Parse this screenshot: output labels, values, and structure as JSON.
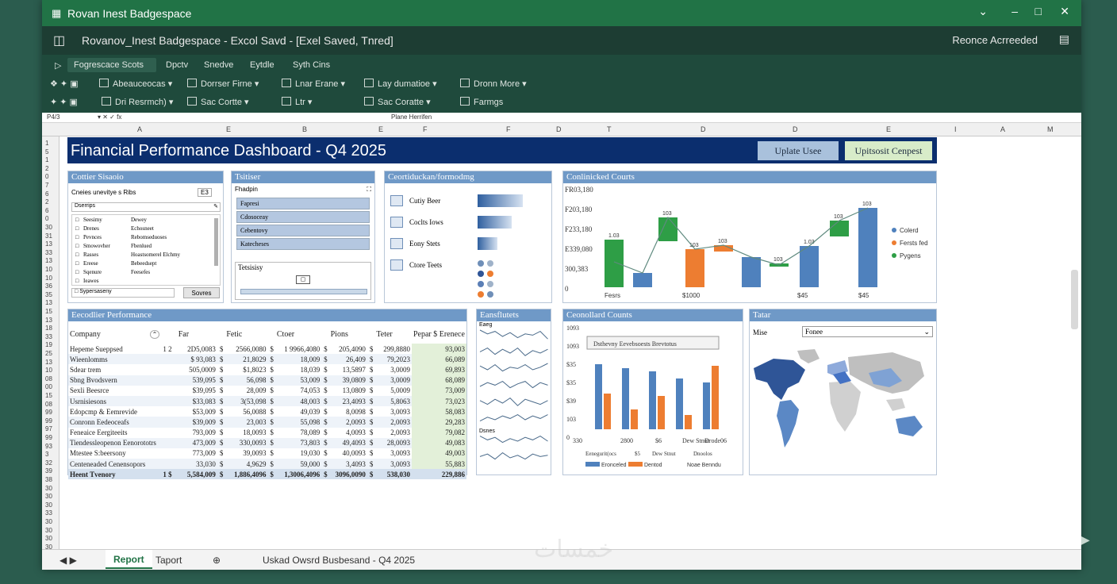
{
  "window": {
    "title": "Rovan Inest Badgespace",
    "app_title": "Rovanov_Inest Badgespace - Excol Savd - [Exel Saved, Tnred]",
    "right_status": "Reonce Acrreeded"
  },
  "ribbon": {
    "tabs": [
      "Fogrescace Scots",
      "Dpctv",
      "Snedve",
      "Eytdle",
      "Syth Cins"
    ],
    "row1": [
      "Abeauceocas",
      "Dorrser Firne",
      "Lnar Erane",
      "Lay dumatioe",
      "Dronn More"
    ],
    "row2": [
      "Dri Resrmch)",
      "Sac Cortte",
      "Ltr",
      "Sac Coratte",
      "Farmgs"
    ]
  },
  "formula": {
    "cell": "P4/3",
    "content": "Plane Herrifen"
  },
  "columns": [
    "A",
    "E",
    "B",
    "E",
    "F",
    "F",
    "D",
    "T",
    "D",
    "D",
    "E",
    "I",
    "A",
    "M"
  ],
  "rows": [
    "1",
    "5",
    "1",
    "2",
    "0",
    "7",
    "6",
    "2",
    "6",
    "0",
    "30",
    "31",
    "13",
    "33",
    "13",
    "10",
    "10",
    "36",
    "35",
    "13",
    "15",
    "13",
    "18",
    "33",
    "19",
    "25",
    "13",
    "10",
    "08",
    "00",
    "15",
    "08",
    "99",
    "99",
    "97",
    "99",
    "93",
    "3",
    "32",
    "39",
    "38",
    "30",
    "30",
    "30",
    "33",
    "30",
    "30",
    "30",
    "30"
  ],
  "dashboard": {
    "title": "Financial Performance Dashboard - Q4 2025",
    "btn_update": "Uplate Usee",
    "btn_export": "Upitsosit Cenpest"
  },
  "filter_panel": {
    "title": "Cottier Sisaoio",
    "top_label": "Cneies unevitye s Ribs",
    "top_value": "E3",
    "search": "Dserrips",
    "rows": [
      [
        "Seesimy",
        "Dewey"
      ],
      [
        "Drenes",
        "Echosneet"
      ],
      [
        "Pevnces",
        "Rebomseduoses"
      ],
      [
        "Smowovher",
        "Fbenlued"
      ],
      [
        "Rasses",
        "Hoastsomerel Elchmy"
      ],
      [
        "Ereese",
        "Bebeedsept"
      ],
      [
        "Sqenure",
        "Feesefes"
      ],
      [
        "Ieawes",
        ""
      ]
    ],
    "footer_label": "Sypersaseny",
    "footer_btn": "Sovres"
  },
  "slicer_panel": {
    "title": "Tsitiser",
    "hdr": "Fhadpin",
    "items": [
      "Fapresi",
      "Cdosoceay",
      "Cebentovy",
      "Katecheses"
    ],
    "slider_label": "Tetsisisy"
  },
  "cond_panel": {
    "title": "Ceortiduckan/formodmg",
    "items": [
      "Cutiy Beer",
      "Coclts Iows",
      "Eony Stets",
      "Ctore Teets"
    ],
    "bars": [
      0.95,
      0.72,
      0.42
    ]
  },
  "waterfall": {
    "title": "Conlinicked Courts",
    "yticks": [
      "FR03,180",
      "F203,180",
      "F233,180",
      "E339,080",
      "300,383",
      "0"
    ],
    "legend": [
      "Colerd",
      "Fersts fed",
      "Pygens"
    ],
    "xlabels": [
      "Fesrs",
      "$1000",
      "$45",
      "$45"
    ]
  },
  "sector_panel": {
    "title": "Eecodlier Performance",
    "headers": [
      "Company",
      "Far",
      "Fetic",
      "Ctoer",
      "Pions",
      "Teter",
      "Pepar $ Erenece"
    ],
    "rows": [
      [
        "Hepeme Sueppsed",
        "1  2",
        "2D5,0083",
        "$",
        "2566,0080",
        "$",
        "1 9966,4080",
        "$",
        "205,4090",
        "$",
        "299,8880",
        "93,003"
      ],
      [
        "Wieenlomms",
        "",
        "$ 93,083",
        "$",
        "21,8029",
        "$",
        "18,009",
        "$",
        "26,409",
        "$",
        "79,2023",
        "66,089"
      ],
      [
        "Sdear trem",
        "",
        "505,0009",
        "$",
        "$1,8023",
        "$",
        "18,039",
        "$",
        "13,5897",
        "$",
        "3,0009",
        "69,893"
      ],
      [
        "Sbng Bvodsvern",
        "",
        "539,095",
        "$",
        "56,098",
        "$",
        "53,009",
        "$",
        "39,0809",
        "$",
        "3,0009",
        "68,089"
      ],
      [
        "Sexli Beesrce",
        "",
        "$39,095",
        "$",
        "28,009",
        "$",
        "74,053",
        "$",
        "13,0809",
        "$",
        "5,0009",
        "73,009"
      ],
      [
        "Usrnisiesons",
        "",
        "$33,083",
        "$",
        "3(53,098",
        "$",
        "48,003",
        "$",
        "23,4093",
        "$",
        "5,8063",
        "73,023"
      ],
      [
        "Edopcmp & Eemrevide",
        "",
        "$53,009",
        "$",
        "56,0088",
        "$",
        "49,039",
        "$",
        "8,0098",
        "$",
        "3,0093",
        "58,083"
      ],
      [
        "Conronn Eedeoceafs",
        "",
        "$39,009",
        "$",
        "23,003",
        "$",
        "55,098",
        "$",
        "2,0093",
        "$",
        "2,0093",
        "29,283"
      ],
      [
        "Feneaice Eergiteeits",
        "",
        "793,009",
        "$",
        "18,0093",
        "$",
        "78,089",
        "$",
        "4,0093",
        "$",
        "2,0093",
        "79,082"
      ],
      [
        "Tiendessleopenon Eenorototrs",
        "",
        "473,009",
        "$",
        "330,0093",
        "$",
        "73,803",
        "$",
        "49,4093",
        "$",
        "28,0093",
        "49,083"
      ],
      [
        "Mtestee S:beersony",
        "",
        "773,009",
        "$",
        "39,0093",
        "$",
        "19,030",
        "$",
        "40,0093",
        "$",
        "3,0093",
        "49,003"
      ],
      [
        "Centeneaded Cenensopors",
        "",
        "33,030",
        "$",
        "4,9629",
        "$",
        "59,000",
        "$",
        "3,4093",
        "$",
        "3,0093",
        "55,883"
      ]
    ],
    "total": [
      "Heent Tvenory",
      "1  $",
      "5,584,009",
      "$",
      "1,886,4096",
      "$",
      "1,3006,4096",
      "$",
      "3096,0090",
      "$",
      "538,030",
      "229,886"
    ]
  },
  "spark_panel": {
    "title": "Eansflutets",
    "labels": [
      "Eaeg",
      "Dsnes"
    ]
  },
  "bar_panel": {
    "title": "Ceonollard Counts",
    "yticks": [
      "1093",
      "1093",
      "$35",
      "$35",
      "$39",
      "103",
      "0"
    ],
    "callout": "Dsthevny Eevebsoests Brevtotus",
    "xlabels": [
      "330",
      "2800",
      "$6",
      "Dew Stnut",
      "Drode06"
    ],
    "xlabels2": [
      "Eenegurit(ocs",
      "$5",
      "Dew Stnut",
      "Dnoolos"
    ],
    "legend": [
      "Eronceled",
      "Dentod",
      "Noae Benndu"
    ],
    "series_a": [
      0.82,
      0.77,
      0.73,
      0.64,
      0.59
    ],
    "series_b": [
      0.45,
      0.25,
      0.42,
      0.18,
      0.8
    ]
  },
  "map_panel": {
    "title": "Tatar",
    "label": "Mise",
    "select": "Fonee"
  },
  "sheets": {
    "active": "Report",
    "other": "Taport",
    "status": "Uskad Owsrd Busbesand - Q4 2025"
  },
  "watermark": "خمسات",
  "colors": {
    "green": "#217346",
    "navy": "#0b2e6e",
    "header_blue": "#6f99c7"
  }
}
